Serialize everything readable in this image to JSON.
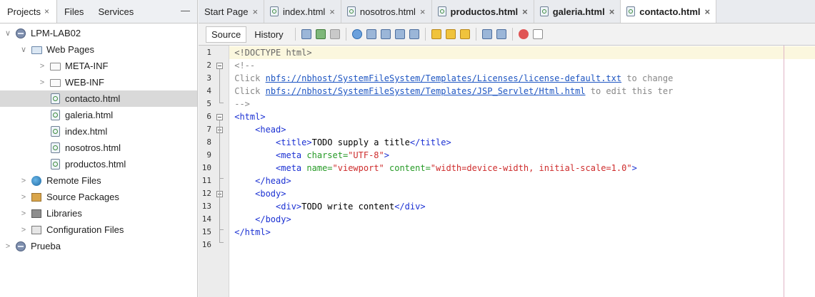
{
  "left_panel": {
    "tabs": [
      {
        "label": "Projects",
        "close": "×"
      },
      {
        "label": "Files"
      },
      {
        "label": "Services"
      }
    ],
    "minimize": "—",
    "tree": [
      {
        "label": "LPM-LAB02",
        "icon": "globe-icon",
        "chevron": "∨"
      },
      {
        "label": "Web Pages",
        "icon": "web-pages-icon",
        "chevron": "∨"
      },
      {
        "label": "META-INF",
        "icon": "folder-icon",
        "chevron": ">"
      },
      {
        "label": "WEB-INF",
        "icon": "folder-icon",
        "chevron": ">"
      },
      {
        "label": "contacto.html",
        "icon": "html-file-icon"
      },
      {
        "label": "galeria.html",
        "icon": "html-file-icon"
      },
      {
        "label": "index.html",
        "icon": "html-file-icon"
      },
      {
        "label": "nosotros.html",
        "icon": "html-file-icon"
      },
      {
        "label": "productos.html",
        "icon": "html-file-icon"
      },
      {
        "label": "Remote Files",
        "icon": "remote-files-icon",
        "chevron": ">"
      },
      {
        "label": "Source Packages",
        "icon": "package-icon",
        "chevron": ">"
      },
      {
        "label": "Libraries",
        "icon": "library-icon",
        "chevron": ">"
      },
      {
        "label": "Configuration Files",
        "icon": "config-files-icon",
        "chevron": ">"
      },
      {
        "label": "Prueba",
        "icon": "globe-icon",
        "chevron": ">"
      }
    ]
  },
  "editor_tabs": [
    {
      "label": "Start Page",
      "close": "×"
    },
    {
      "label": "index.html",
      "close": "×"
    },
    {
      "label": "nosotros.html",
      "close": "×"
    },
    {
      "label": "productos.html",
      "close": "×"
    },
    {
      "label": "galeria.html",
      "close": "×"
    },
    {
      "label": "contacto.html",
      "close": "×"
    }
  ],
  "toolbar": {
    "source_label": "Source",
    "history_label": "History"
  },
  "code": {
    "line_numbers": [
      "1",
      "2",
      "3",
      "4",
      "5",
      "6",
      "7",
      "8",
      "9",
      "10",
      "11",
      "12",
      "13",
      "14",
      "15",
      "16"
    ],
    "l1": "<!DOCTYPE html>",
    "l2": "<!--",
    "l3_pre": "Click ",
    "l3_link": "nbfs://nbhost/SystemFileSystem/Templates/Licenses/license-default.txt",
    "l3_post": " to change",
    "l4_pre": "Click ",
    "l4_link": "nbfs://nbhost/SystemFileSystem/Templates/JSP_Servlet/Html.html",
    "l4_post": " to edit this ter",
    "l5": "-->",
    "l6": "<html>",
    "l7": "<head>",
    "l8_open": "<title>",
    "l8_text": "TODO supply a title",
    "l8_close": "</title>",
    "l9_tag": "<meta ",
    "l9_attr": "charset=",
    "l9_val": "\"UTF-8\"",
    "l9_end": ">",
    "l10_tag": "<meta ",
    "l10_attr1": "name=",
    "l10_val1": "\"viewport\"",
    "l10_attr2": " content=",
    "l10_val2": "\"width=device-width, initial-scale=1.0\"",
    "l10_end": ">",
    "l11": "</head>",
    "l12": "<body>",
    "l13_open": "<div>",
    "l13_text": "TODO write content",
    "l13_close": "</div>",
    "l14": "</body>",
    "l15": "</html>"
  },
  "colors": {
    "tag": "#1b31d3",
    "attribute": "#269a26",
    "value": "#ce2c2c",
    "comment": "#888888",
    "link": "#1d55c2",
    "current_line": "#fbf7de"
  }
}
